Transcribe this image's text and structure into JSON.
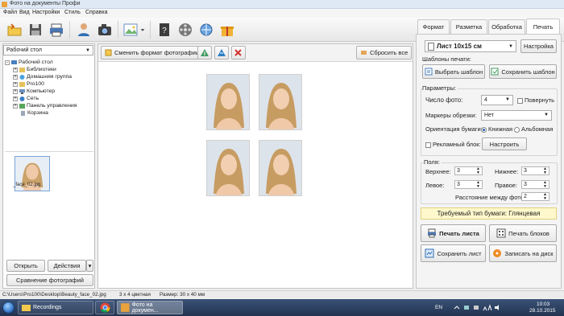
{
  "window": {
    "title": "Фото на документы Профи"
  },
  "menu": [
    "Файл",
    "Вид",
    "Настройки",
    "Стиль",
    "Справка"
  ],
  "tabs": [
    {
      "label": "Формат",
      "active": false
    },
    {
      "label": "Разметка",
      "active": false
    },
    {
      "label": "Обработка",
      "active": false
    },
    {
      "label": "Печать",
      "active": true
    }
  ],
  "left": {
    "location": "Рабочий стол",
    "tree": [
      {
        "label": "Рабочий стол",
        "level": 0,
        "expander": "-"
      },
      {
        "label": "Библиотеки",
        "level": 1,
        "expander": "+"
      },
      {
        "label": "Домашняя группа",
        "level": 1,
        "expander": "+"
      },
      {
        "label": "Pro100",
        "level": 1,
        "expander": "+"
      },
      {
        "label": "Компьютер",
        "level": 1,
        "expander": "+"
      },
      {
        "label": "Сеть",
        "level": 1,
        "expander": "+"
      },
      {
        "label": "Панель управления",
        "level": 1,
        "expander": "+"
      },
      {
        "label": "Корзина",
        "level": 1,
        "expander": ""
      }
    ],
    "thumbnail_label": "_face_02.jpg",
    "open_label": "Открыть",
    "actions_label": "Действия",
    "compare_label": "Сравнение фотографий"
  },
  "center": {
    "change_format_label": "Сменить формат фотографии",
    "reset_all_label": "Сбросить все"
  },
  "right": {
    "sheet_value": "Лист 10x15 см",
    "settings_label": "Настройка",
    "templates_heading": "Шаблоны печати:",
    "choose_template_label": "Выбрать шаблон",
    "save_template_label": "Сохранить шаблон",
    "params_heading": "Параметры:",
    "photo_count_label": "Число фото:",
    "photo_count_value": "4",
    "rotate_label": "Повернуть",
    "crop_markers_label": "Маркеры обрезки:",
    "crop_markers_value": "Нет",
    "orientation_label": "Ориентация бумаги:",
    "portrait_label": "Книжная",
    "landscape_label": "Альбомная",
    "ad_block_label": "Рекламный блок:",
    "ad_setup_label": "Настроить",
    "margins_heading": "Поля:",
    "top_label": "Верхнее:",
    "top_value": "3",
    "bottom_label": "Нижнее:",
    "bottom_value": "3",
    "left_label": "Левое:",
    "left_value": "3",
    "right_label": "Правое:",
    "right_value": "3",
    "spacing_label": "Расстояние между фото:",
    "spacing_value": "2",
    "paper_type": "Требуемый тип бумаги: Глянцевая",
    "print_sheet_label": "Печать листа",
    "print_blocks_label": "Печать блоков",
    "save_sheet_label": "Сохранить лист",
    "burn_disk_label": "Записать на диск"
  },
  "status": {
    "path": "C:\\Users\\Pro100\\Desktop\\Beauty_face_02.jpg",
    "format": "3 x 4 цветная",
    "size": "Размер: 30 x 40 мм"
  },
  "taskbar": {
    "items": [
      "Recordings",
      "",
      "Фото на докумен..."
    ],
    "lang": "EN",
    "time": "10:03",
    "date": "28.10.2015"
  },
  "colors": {
    "accent": "#2b5fb0",
    "banner_bg": "#fff8cc",
    "taskbar": "#223350"
  }
}
